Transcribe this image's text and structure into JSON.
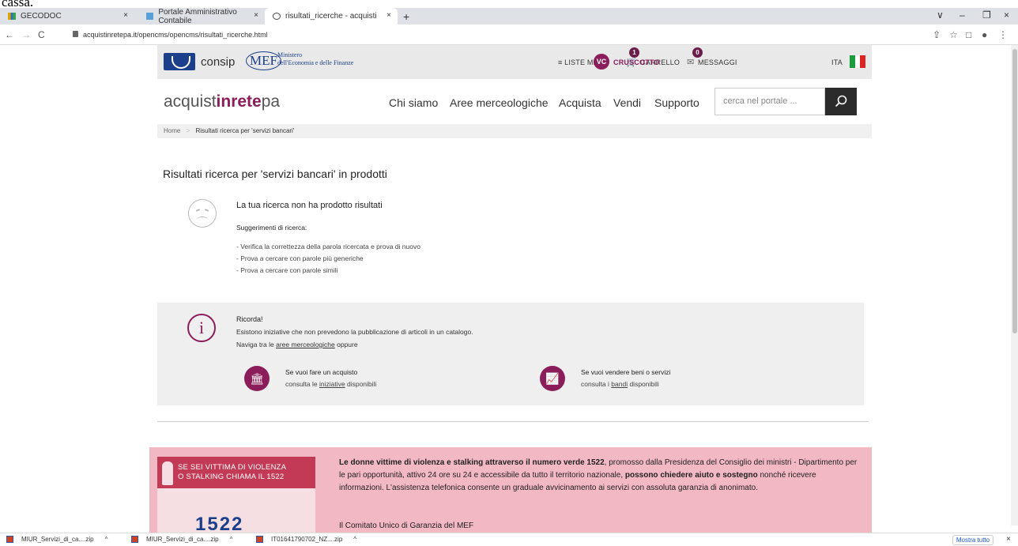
{
  "cut_text": "cassa.",
  "browser": {
    "tabs": [
      {
        "label": "GECODOC",
        "close": "×"
      },
      {
        "label": "Portale Amministrativo Contabile",
        "close": "×"
      },
      {
        "label": "risultati_ricerche - acquistinretepa",
        "close": "×"
      }
    ],
    "new_tab": "+",
    "window_controls": [
      "∨",
      "–",
      "❐",
      "×"
    ],
    "url": "acquistinretepa.it/opencms/opencms/risultati_ricerche.html",
    "nav": [
      "←",
      "→",
      "C"
    ],
    "right_icons": [
      "⇪",
      "☆",
      "□",
      "●",
      "⋮"
    ]
  },
  "topbar": {
    "consip": "consip",
    "mef": "MEF",
    "ministero_line1": "Ministero",
    "ministero_line2": "dell'Economia e delle Finanze",
    "liste_mepa": "≡ LISTE MEPA",
    "carrello": "CARRELLO",
    "carrello_count": "1",
    "messaggi": "MESSAGGI",
    "messaggi_count": "0",
    "vc": "VC",
    "cruscotto": "CRUSCOTTO",
    "lang": "ITA"
  },
  "header": {
    "brand_a": "acquist",
    "brand_b": "inrete",
    "brand_c": "pa",
    "nav": [
      "Chi siamo",
      "Aree merceologiche",
      "Acquista",
      "Vendi",
      "Supporto"
    ],
    "search_placeholder": "cerca nel portale ..."
  },
  "breadcrumb": {
    "home": "Home",
    "sep": ">",
    "current": "Risultati ricerca per 'servizi bancari'"
  },
  "results": {
    "title": "Risultati ricerca per 'servizi bancari' in prodotti",
    "no_results": "La tua ricerca non ha prodotto risultati",
    "suggestions_title": "Suggerimenti di ricerca:",
    "suggestions": [
      "- Verifica la correttezza della parola ricercata e prova di nuovo",
      "- Prova a cercare con parole più generiche",
      "- Prova a cercare con parole simili"
    ]
  },
  "remind": {
    "title": "Ricorda!",
    "line1": "Esistono iniziative che non prevedono la pubblicazione di articoli in un catalogo.",
    "line2_a": "Naviga tra le ",
    "line2_link": "aree merceologiche",
    "line2_b": " oppure",
    "buy_title": "Se vuoi fare un acquisto",
    "buy_a": "consulta le ",
    "buy_link": "iniziative",
    "buy_b": " disponibili",
    "sell_title": "Se vuoi vendere beni o servizi",
    "sell_a": "consulta i ",
    "sell_link": "bandi",
    "sell_b": " disponibili"
  },
  "banner": {
    "poster_line1": "SE SEI VITTIMA DI VIOLENZA",
    "poster_line2": "O STALKING CHIAMA IL 1522",
    "poster_number": "1522",
    "text_bold1": "Le donne vittime di violenza e stalking attraverso il numero verde 1522",
    "text_1": ", promosso dalla Presidenza del Consiglio dei ministri - Dipartimento per le pari opportunità, attivo 24 ore su 24 e accessibile da tutto il territorio nazionale, ",
    "text_bold2": "possono chiedere aiuto e sostegno",
    "text_2": " nonché ricevere informazioni. L'assistenza telefonica consente un graduale avvicinamento ai servizi con assoluta garanzia di anonimato.",
    "text_cut": "Il Comitato Unico di Garanzia del MEF"
  },
  "downloads": {
    "items": [
      "MIUR_Servizi_di_ca....zip",
      "MIUR_Servizi_di_ca....zip",
      "IT01641790702_NZ....zip"
    ],
    "chevron": "^",
    "show_all": "Mostra tutto",
    "close": "×"
  },
  "colors": {
    "brand": "#8b1d5a",
    "mef_blue": "#1b3f8a",
    "pink_banner": "#f2b9c4"
  }
}
